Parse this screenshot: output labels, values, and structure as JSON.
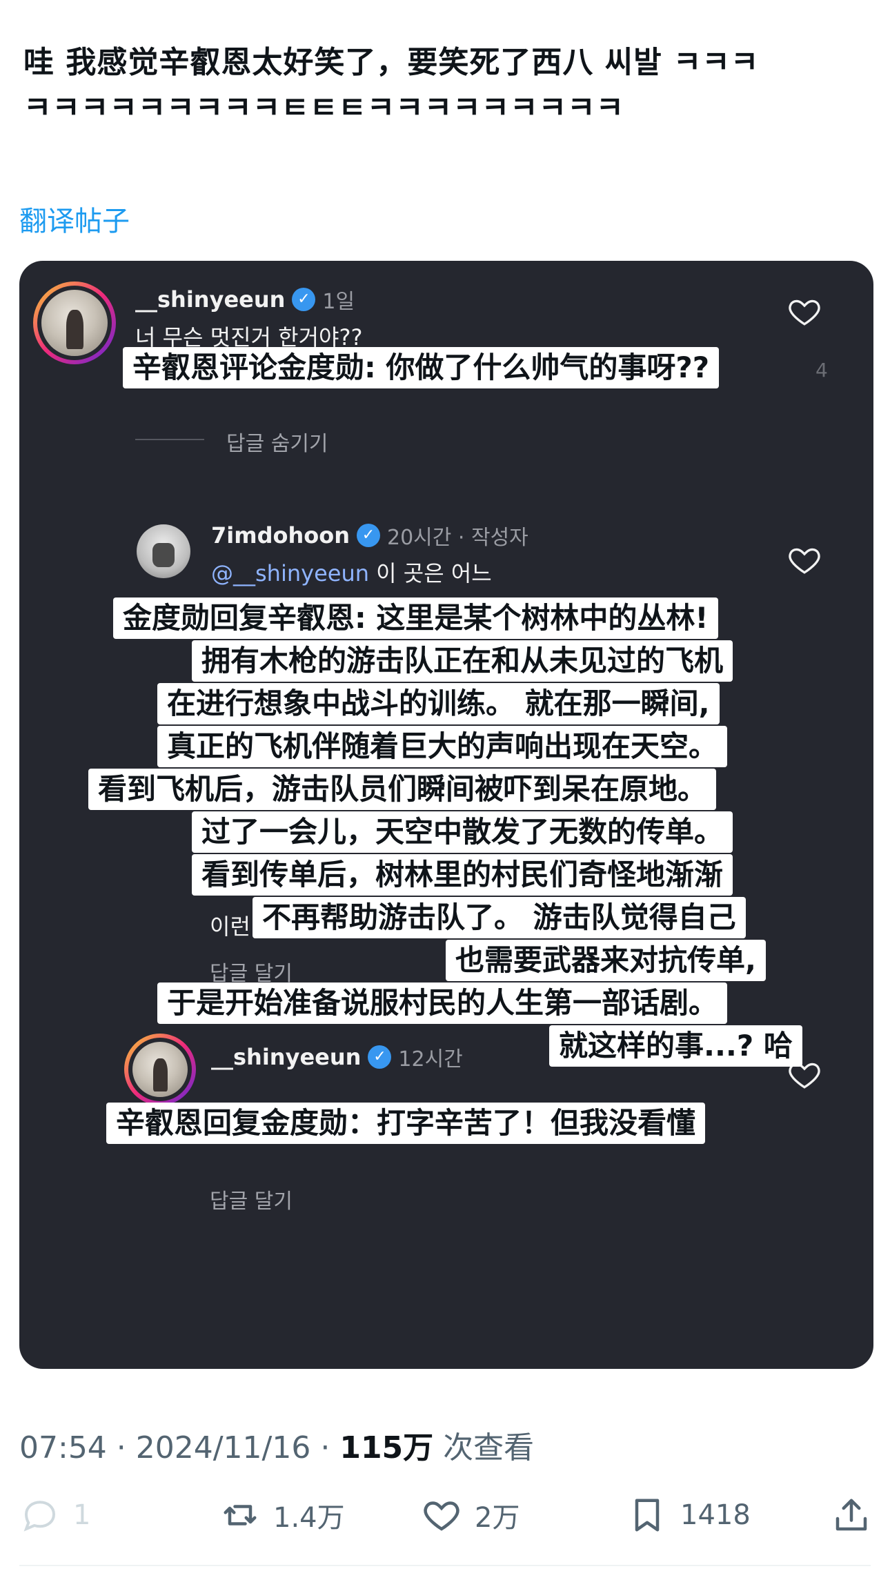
{
  "post": {
    "line1": "哇 我感觉辛叡恩太好笑了，要笑死了西八  씨발 ㅋㅋㅋ",
    "line2": "ㅋㅋㅋㅋㅋㅋㅋㅋㅋㅌㅌㅌㅋㅋㅋㅋㅋㅋㅋㅋㅋ",
    "translate_label": "翻译帖子"
  },
  "comments": [
    {
      "username": "__shinyeeun",
      "time": "1일",
      "text": "너 무슨 멋진거 한거야??",
      "hide_replies": "답글 숨기기",
      "translation": "辛叡恩评论金度勋: 你做了什么帅气的事呀??"
    },
    {
      "username": "7imdohoon",
      "time": "20시간 · 작성자",
      "mention": "@__shinyeeun",
      "text_after_mention": " 이 곳은 어느",
      "partial_text": "이런",
      "reply_action": "답글 달기",
      "translation_lines": [
        "金度勋回复辛叡恩: 这里是某个树林中的丛林!",
        "拥有木枪的游击队正在和从未见过的飞机",
        "在进行想象中战斗的训练。 就在那一瞬间,",
        "真正的飞机伴随着巨大的声响出现在天空。",
        "看到飞机后，游击队员们瞬间被吓到呆在原地。",
        "过了一会儿，天空中散发了无数的传单。",
        "看到传单后，树林里的村民们奇怪地渐渐",
        "不再帮助游击队了。 游击队觉得自己",
        "也需要武器来对抗传单,",
        "于是开始准备说服村民的人生第一部话剧。",
        "就这样的事...? 哈"
      ]
    },
    {
      "username": "__shinyeeun",
      "time": "12시간",
      "reply_action": "답글 달기",
      "translation": "辛叡恩回复金度勋：打字辛苦了！但我没看懂"
    }
  ],
  "meta": {
    "time_date": "07:54 · 2024/11/16 · ",
    "views": "115万",
    "views_label": " 次查看"
  },
  "actions": {
    "reply_count": "1",
    "retweet_count": "1.4万",
    "like_count": "2万",
    "bookmark_count": "1418"
  },
  "colors": {
    "link": "#1d9bf0",
    "card_bg": "#25272f",
    "verified": "#3897f0"
  }
}
